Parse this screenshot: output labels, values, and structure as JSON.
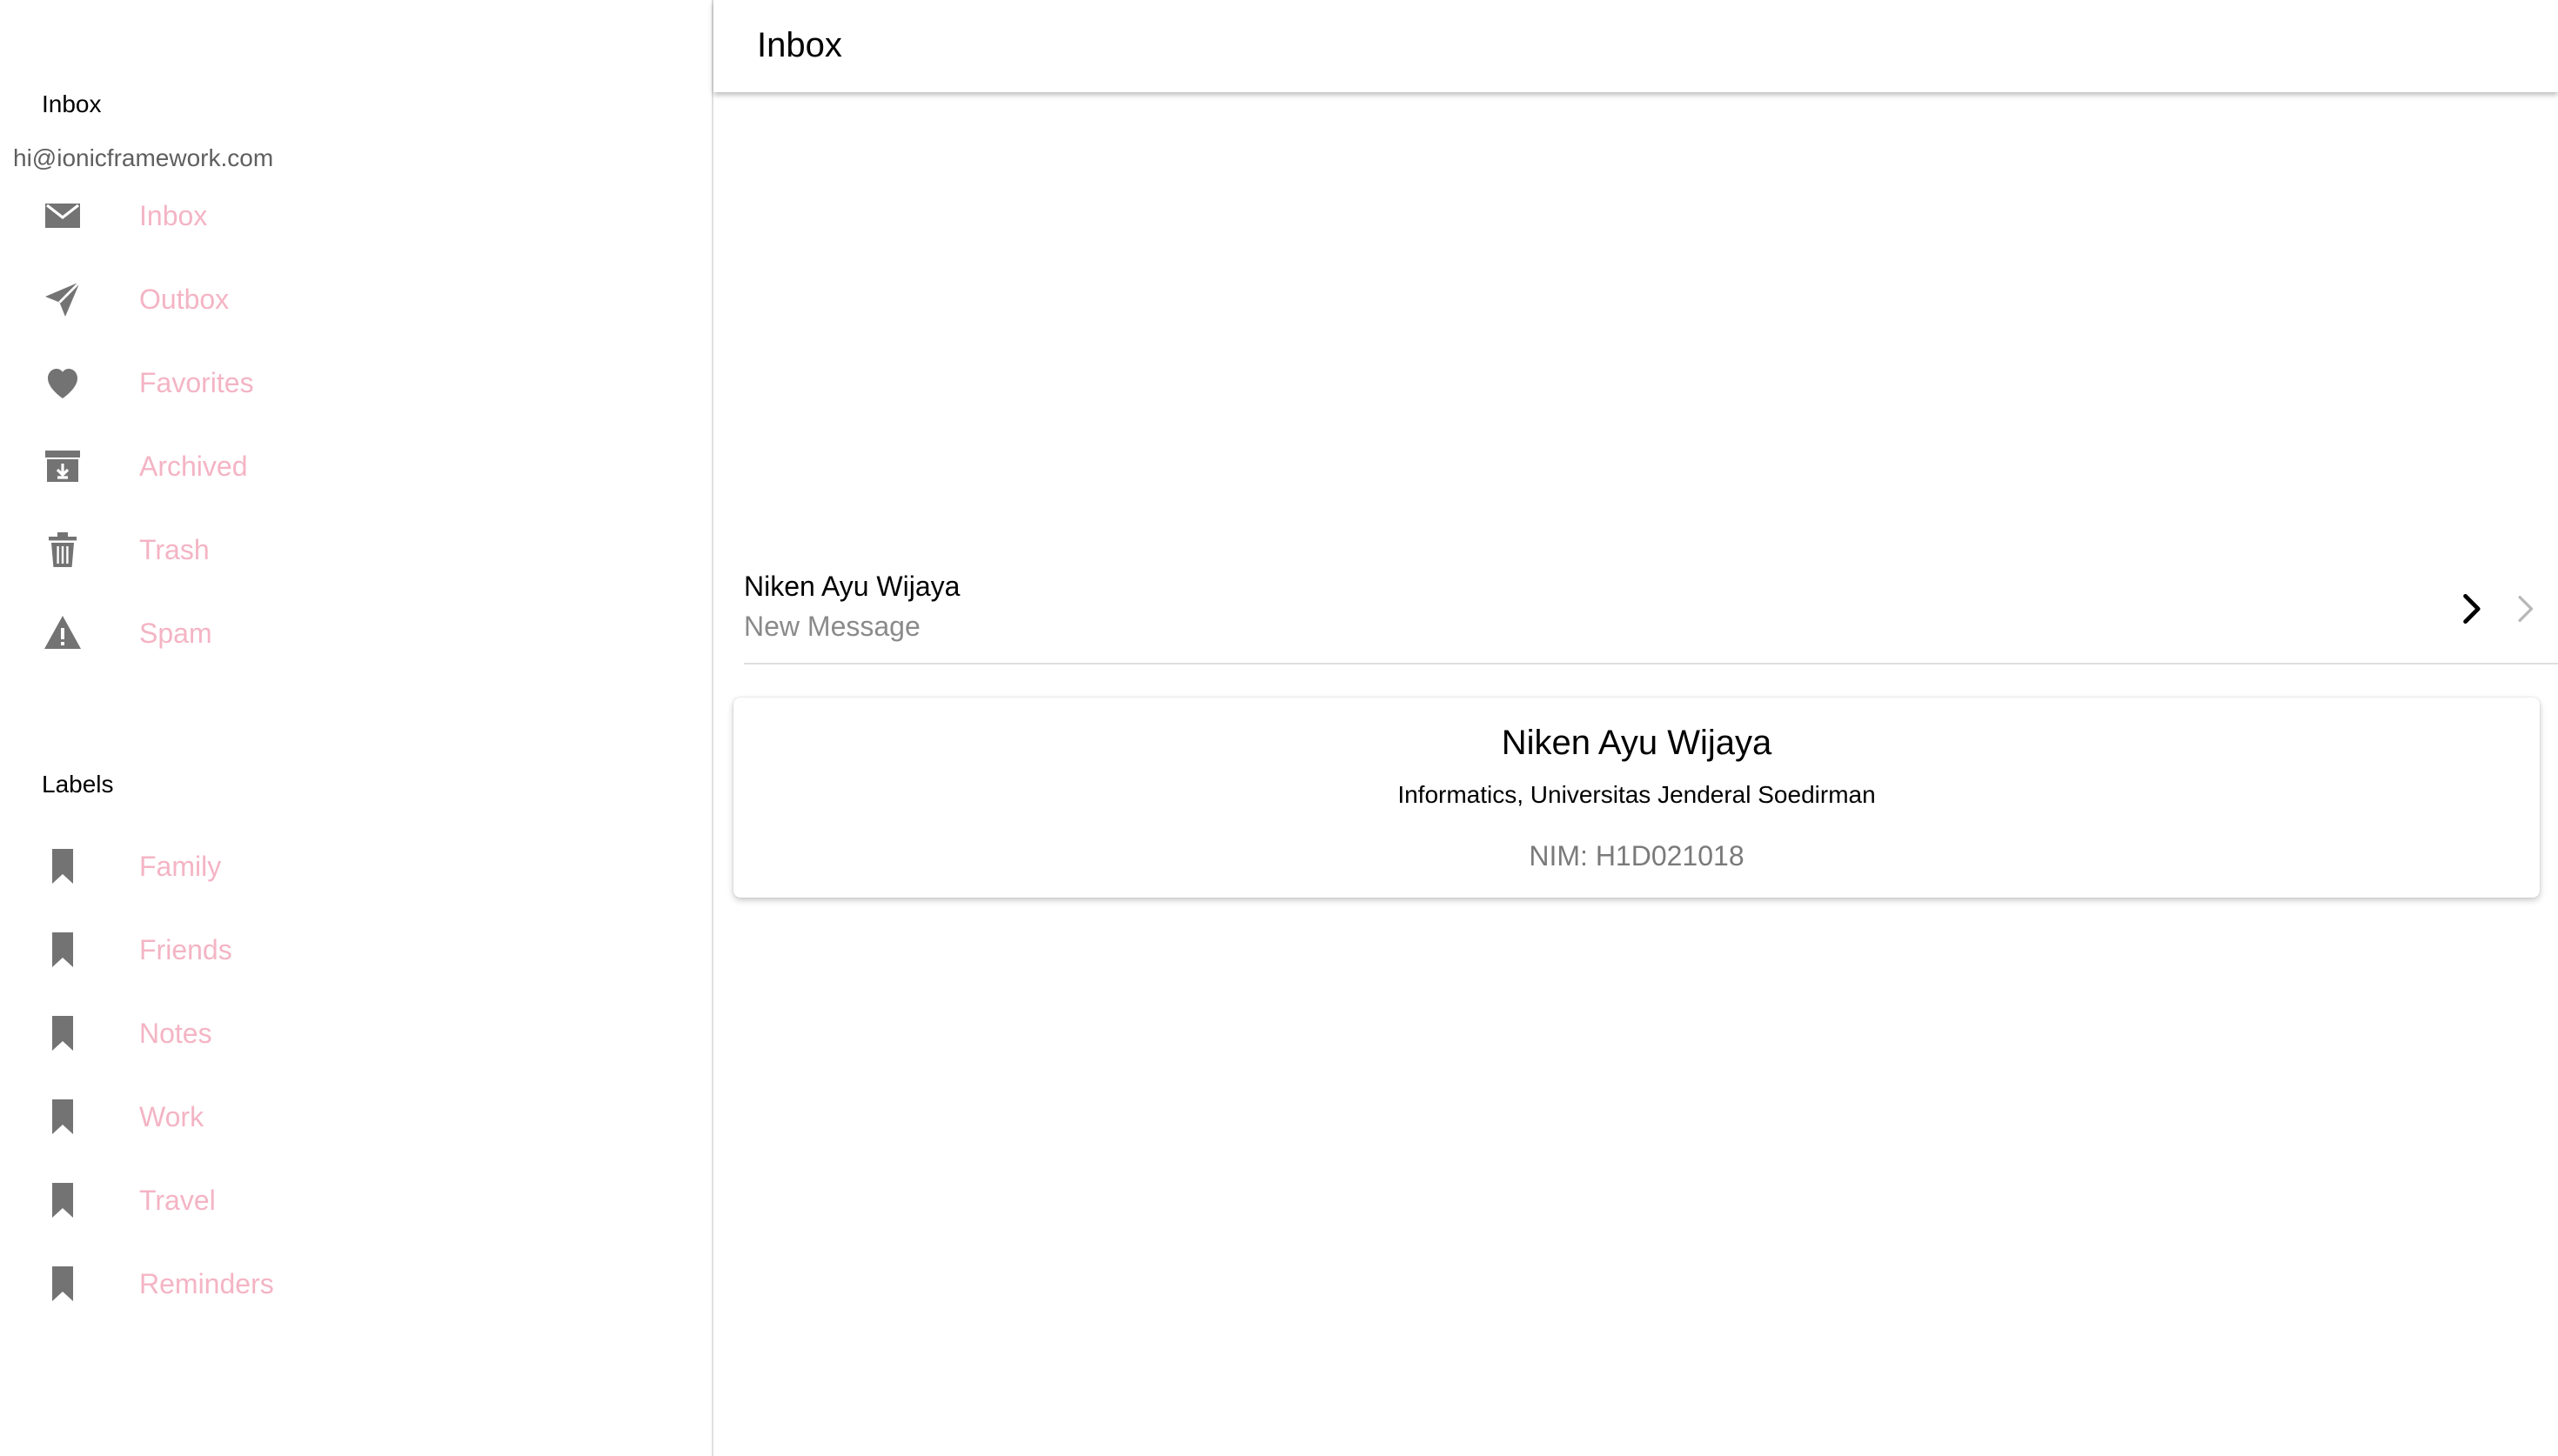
{
  "colors": {
    "menu_label": "#f4b4c4",
    "icon": "#737373",
    "note": "#5f5f5f",
    "subject": "#8a8a8a"
  },
  "sidebar": {
    "inbox_header": "Inbox",
    "email_note": "hi@ionicframework.com",
    "folders": [
      {
        "label": "Inbox",
        "icon": "mail-icon"
      },
      {
        "label": "Outbox",
        "icon": "paper-plane-icon"
      },
      {
        "label": "Favorites",
        "icon": "heart-icon"
      },
      {
        "label": "Archived",
        "icon": "archive-icon"
      },
      {
        "label": "Trash",
        "icon": "trash-icon"
      },
      {
        "label": "Spam",
        "icon": "warning-icon"
      }
    ],
    "labels_header": "Labels",
    "labels": [
      {
        "label": "Family",
        "icon": "bookmark-icon"
      },
      {
        "label": "Friends",
        "icon": "bookmark-icon"
      },
      {
        "label": "Notes",
        "icon": "bookmark-icon"
      },
      {
        "label": "Work",
        "icon": "bookmark-icon"
      },
      {
        "label": "Travel",
        "icon": "bookmark-icon"
      },
      {
        "label": "Reminders",
        "icon": "bookmark-icon"
      }
    ]
  },
  "header": {
    "title": "Inbox"
  },
  "message": {
    "sender": "Niken Ayu Wijaya",
    "subject": "New Message"
  },
  "profile_card": {
    "name": "Niken Ayu Wijaya",
    "department": "Informatics, Universitas Jenderal Soedirman",
    "nim": "NIM: H1D021018"
  }
}
